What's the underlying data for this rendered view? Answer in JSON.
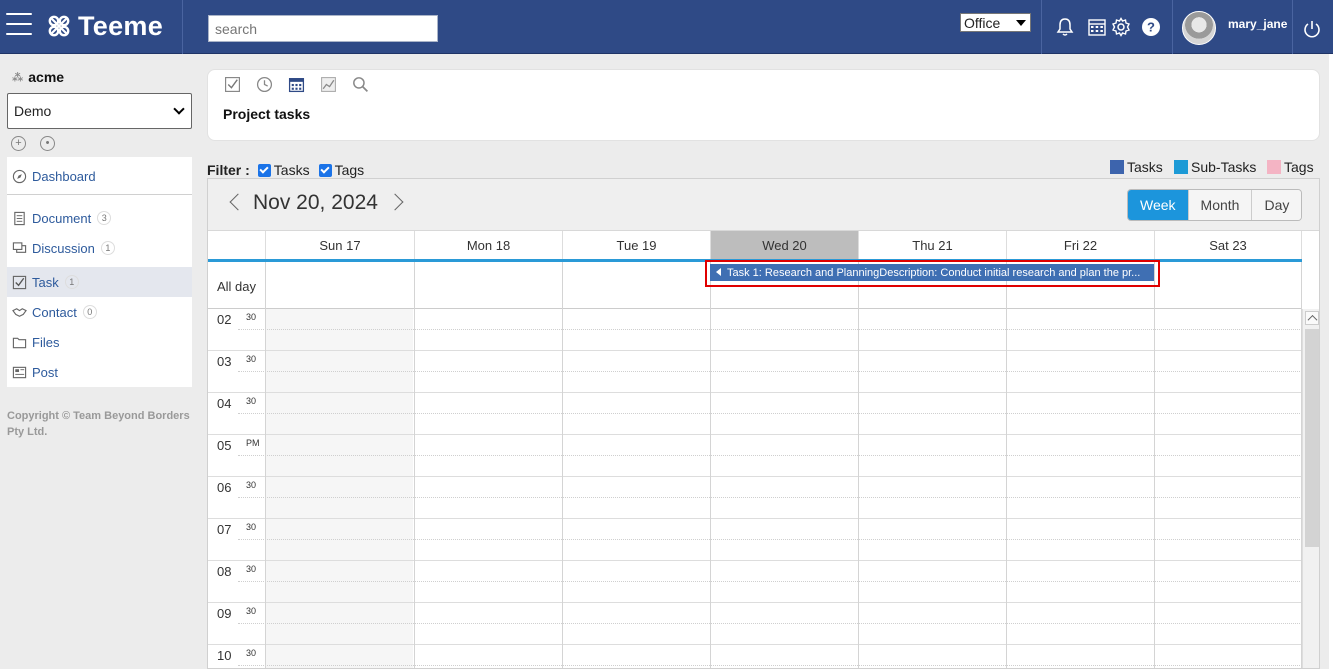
{
  "app": {
    "name": "Teeme",
    "search_placeholder": "search",
    "office": "Office",
    "username": "mary_jane"
  },
  "sidebar": {
    "org": "acme",
    "project": "Demo",
    "items": [
      {
        "label": "Dashboard",
        "badge": ""
      },
      {
        "label": "Document",
        "badge": "3"
      },
      {
        "label": "Discussion",
        "badge": "1"
      },
      {
        "label": "Task",
        "badge": "1"
      },
      {
        "label": "Contact",
        "badge": "0"
      },
      {
        "label": "Files",
        "badge": ""
      },
      {
        "label": "Post",
        "badge": ""
      }
    ],
    "copyright": "Copyright © Team Beyond Borders Pty Ltd."
  },
  "header": {
    "title": "Project tasks"
  },
  "filter": {
    "label": "Filter :",
    "tasks": "Tasks",
    "tags": "Tags"
  },
  "legend": [
    {
      "label": "Tasks",
      "color": "#3d64ad"
    },
    {
      "label": "Sub-Tasks",
      "color": "#1c9ad6"
    },
    {
      "label": "Tags",
      "color": "#f4b4c4"
    }
  ],
  "calendar": {
    "date": "Nov 20, 2024",
    "views": [
      "Week",
      "Month",
      "Day"
    ],
    "selected_view": "Week",
    "days": [
      "Sun 17",
      "Mon 18",
      "Tue 19",
      "Wed 20",
      "Thu 21",
      "Fri 22",
      "Sat 23"
    ],
    "today": "Wed 20",
    "all_day_label": "All day",
    "event": "Task 1: Research and PlanningDescription: Conduct initial research and plan the pr...",
    "hours": [
      {
        "h": "02",
        "s": "30"
      },
      {
        "h": "03",
        "s": "30"
      },
      {
        "h": "04",
        "s": "30"
      },
      {
        "h": "05",
        "s": "PM"
      },
      {
        "h": "06",
        "s": "30"
      },
      {
        "h": "07",
        "s": "30"
      },
      {
        "h": "08",
        "s": "30"
      },
      {
        "h": "09",
        "s": "30"
      },
      {
        "h": "10",
        "s": "30"
      }
    ]
  }
}
